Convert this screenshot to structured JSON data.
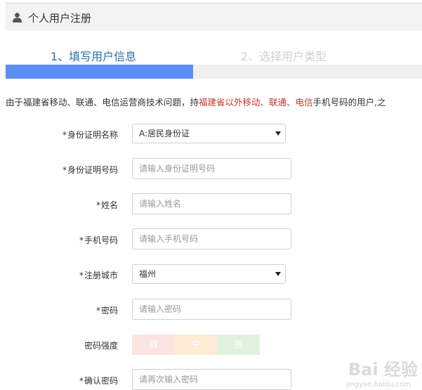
{
  "header": {
    "title": "个人用户注册",
    "icon": "user-icon"
  },
  "steps": {
    "step1": "1、填写用户信息",
    "step2": "2、选择用户类型",
    "progress": 0.45,
    "active_color": "#2e6fb0",
    "inactive_color": "#cfcfcf",
    "bar_color": "#5b8ff2"
  },
  "notice": {
    "part1": "由于福建省移动、联通、电信运营商技术问题，持",
    "part2": "福建省以外移动",
    "part3": "、",
    "part4": "联通",
    "part5": "、",
    "part6": "电信",
    "part7": "手机号码的用户,",
    "part8": "之"
  },
  "form": {
    "id_type": {
      "label": "身份证明名称",
      "value": "A:居民身份证"
    },
    "id_number": {
      "label": "身份证明号码",
      "placeholder": "请输入身份证明号码"
    },
    "name": {
      "label": "姓名",
      "placeholder": "请输入姓名"
    },
    "phone": {
      "label": "手机号码",
      "placeholder": "请输入手机号码"
    },
    "city": {
      "label": "注册城市",
      "value": "福州"
    },
    "password": {
      "label": "密码",
      "placeholder": "请输入密码"
    },
    "strength": {
      "label": "密码强度",
      "weak": "弱",
      "medium": "中",
      "strong": "强"
    },
    "confirm": {
      "label": "确认密码",
      "placeholder": "请再次输入密码"
    },
    "required_mark": "*"
  },
  "watermark": {
    "brand": "Bai  经验",
    "url": "jingyan.baidu.com"
  }
}
